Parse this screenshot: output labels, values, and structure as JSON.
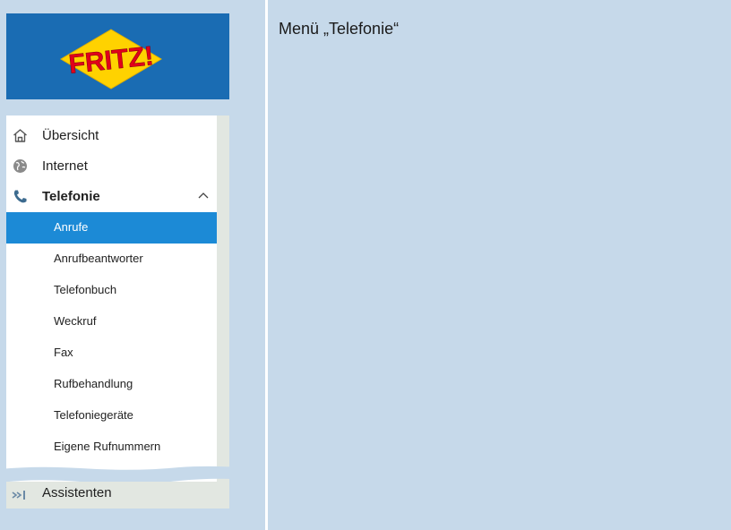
{
  "caption": "Menü „Telefonie“",
  "logo": {
    "text": "FRITZ!"
  },
  "nav": {
    "items": [
      {
        "label": "Übersicht",
        "icon": "home-icon"
      },
      {
        "label": "Internet",
        "icon": "globe-icon"
      },
      {
        "label": "Telefonie",
        "icon": "phone-icon",
        "expanded": true
      }
    ],
    "telefonie_sub": [
      {
        "label": "Anrufe",
        "active": true
      },
      {
        "label": "Anrufbeantworter"
      },
      {
        "label": "Telefonbuch"
      },
      {
        "label": "Weckruf"
      },
      {
        "label": "Fax"
      },
      {
        "label": "Rufbehandlung"
      },
      {
        "label": "Telefoniegeräte"
      },
      {
        "label": "Eigene Rufnummern"
      }
    ],
    "assistant": {
      "label": "Assistenten",
      "icon": "wizard-icon"
    }
  },
  "colors": {
    "background": "#c6d9ea",
    "header_blue": "#1a6cb3",
    "active_blue": "#1c8ad6",
    "logo_red": "#e2001a",
    "logo_yellow": "#ffd200"
  }
}
